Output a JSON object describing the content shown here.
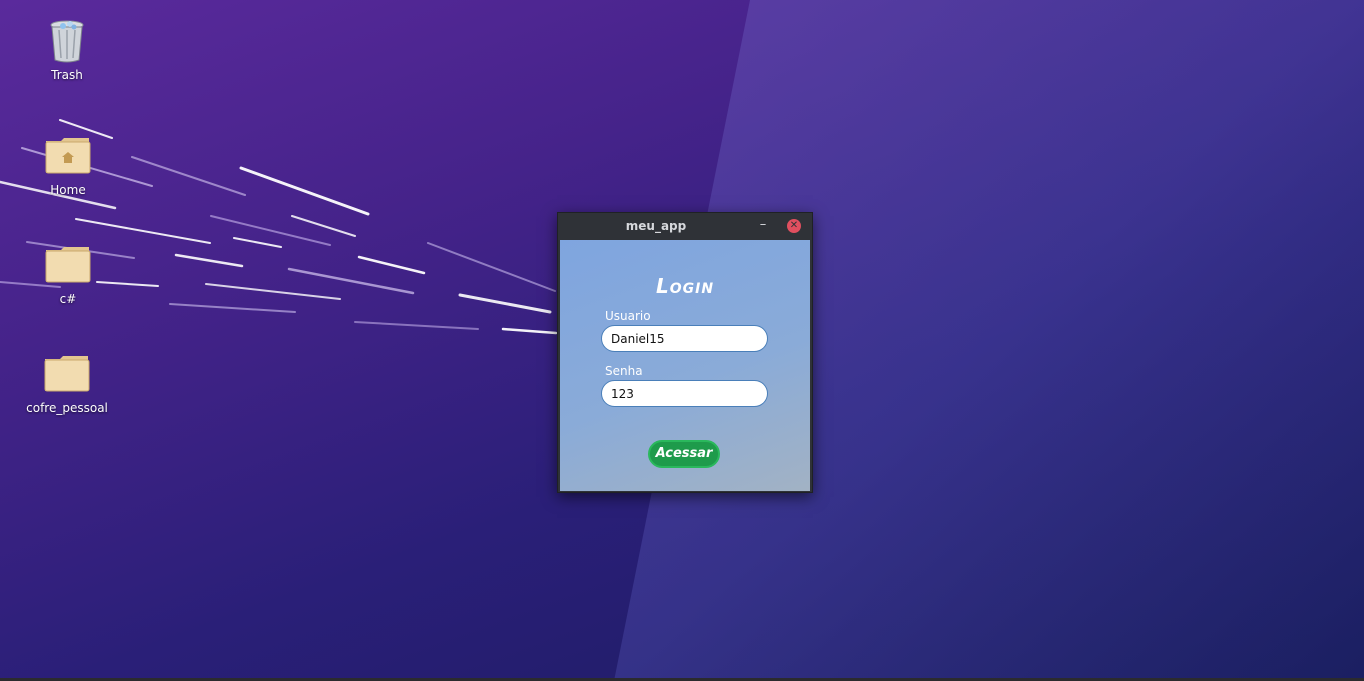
{
  "desktop": {
    "icons": [
      {
        "label": "Trash",
        "icon": "trash-icon"
      },
      {
        "label": "Home",
        "icon": "home-folder-icon"
      },
      {
        "label": "c#",
        "icon": "folder-icon"
      },
      {
        "label": "cofre_pessoal",
        "icon": "folder-icon"
      }
    ]
  },
  "window": {
    "title": "meu_app",
    "minimize_label": "–",
    "close_label": "✕",
    "heading": "Login",
    "username_label": "Usuario",
    "username_value": "Daniel15",
    "password_label": "Senha",
    "password_value": "123",
    "submit_label": "Acessar"
  },
  "colors": {
    "client_background": "#8aabd8",
    "submit_button": "#1e9b4b",
    "close_button": "#e04f5f",
    "titlebar": "#2f3237"
  }
}
